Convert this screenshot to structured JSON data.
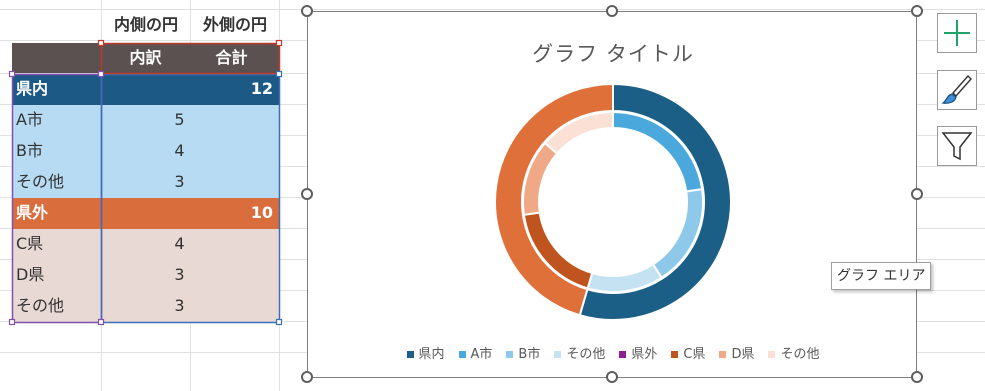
{
  "sheet": {
    "col_headers": [
      "内側の円",
      "外側の円"
    ],
    "table_header": {
      "col1": "内訳",
      "col2": "合計"
    },
    "rows": [
      {
        "label": "県内",
        "inner": "",
        "total": "12"
      },
      {
        "label": "A市",
        "inner": "5",
        "total": ""
      },
      {
        "label": "B市",
        "inner": "4",
        "total": ""
      },
      {
        "label": "その他",
        "inner": "3",
        "total": ""
      },
      {
        "label": "県外",
        "inner": "",
        "total": "10"
      },
      {
        "label": "C県",
        "inner": "4",
        "total": ""
      },
      {
        "label": "D県",
        "inner": "3",
        "total": ""
      },
      {
        "label": "その他",
        "inner": "3",
        "total": ""
      }
    ]
  },
  "chart": {
    "title": "グラフ タイトル",
    "tooltip": "グラフ エリア",
    "legend": [
      {
        "label": "県内",
        "color": "#1b5f87"
      },
      {
        "label": "A市",
        "color": "#4aa8dc"
      },
      {
        "label": "B市",
        "color": "#8ec9ea"
      },
      {
        "label": "その他",
        "color": "#c5e2f3"
      },
      {
        "label": "県外",
        "color": "#8e1f8e"
      },
      {
        "label": "C県",
        "color": "#c0541e"
      },
      {
        "label": "D県",
        "color": "#f0a987"
      },
      {
        "label": "その他",
        "color": "#fbe0d6"
      }
    ]
  },
  "side_buttons": {
    "add": "plus-icon",
    "style": "brush-icon",
    "filter": "filter-icon"
  },
  "chart_data": {
    "type": "doughnut",
    "title": "グラフ タイトル",
    "outer": {
      "categories": [
        "県内",
        "県外"
      ],
      "values": [
        12,
        10
      ]
    },
    "inner": {
      "categories": [
        "A市",
        "B市",
        "その他",
        "C県",
        "D県",
        "その他"
      ],
      "values": [
        5,
        4,
        3,
        4,
        3,
        3
      ]
    },
    "colors": {
      "outer": [
        "#1b5f87",
        "#e0703a"
      ],
      "inner": [
        "#4aa8dc",
        "#8ec9ea",
        "#c5e2f3",
        "#c0541e",
        "#f0a987",
        "#fbe0d6"
      ]
    },
    "legend_position": "bottom"
  }
}
